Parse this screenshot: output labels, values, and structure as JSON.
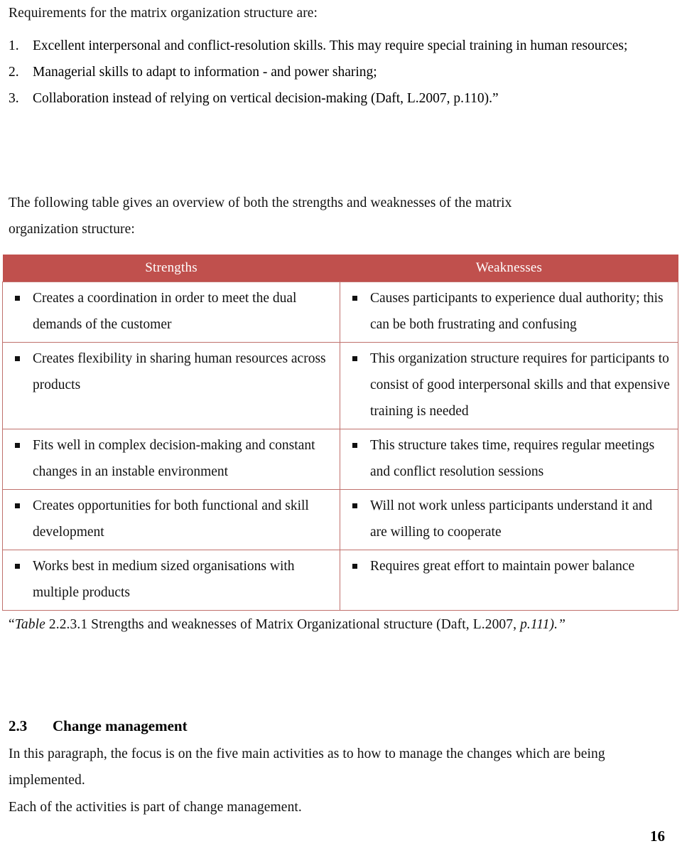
{
  "document": {
    "intro_heading": "Requirements for the matrix organization structure are:",
    "requirements": [
      {
        "num": "1.",
        "text": "Excellent interpersonal and conflict-resolution skills. This may require special training in human resources;"
      },
      {
        "num": "2.",
        "text": "Managerial skills to adapt to information - and power sharing;"
      },
      {
        "num": "3.",
        "text": "Collaboration instead of relying on vertical decision-making (Daft, L.2007, p.110).”"
      }
    ],
    "lead_paragraph": "The following table gives an overview of both the strengths and weaknesses of the matrix organization structure:",
    "table": {
      "headers": [
        "Strengths",
        "Weaknesses"
      ],
      "header_bg": "#C0504D",
      "header_text_color": "#FFFFFF",
      "border_color": "#C0706C",
      "rows": [
        {
          "strength": "Creates a coordination in order to meet the dual demands of the customer",
          "weakness": "Causes participants to experience dual authority; this can be both frustrating and confusing"
        },
        {
          "strength": "Creates flexibility in sharing human resources across products",
          "weakness": "This organization structure requires for participants to consist of good interpersonal skills and that expensive training is needed"
        },
        {
          "strength": "Fits well in complex decision-making and constant changes in an instable environment",
          "weakness": "This structure takes time, requires regular meetings and conflict resolution sessions"
        },
        {
          "strength": "Creates opportunities for both functional and skill development",
          "weakness": "Will not work unless participants understand it and are willing to cooperate"
        },
        {
          "strength": "Works best in medium sized organisations with multiple products",
          "weakness": "Requires great effort to maintain power balance"
        }
      ]
    },
    "caption": {
      "open_quote": "“",
      "italic_word": "Table",
      "rest": " 2.2.3.1 Strengths and weaknesses of Matrix Organizational structure (Daft, L.2007, ",
      "second_line": "p.111).”"
    },
    "section": {
      "number": "2.3",
      "title": "Change management",
      "paragraph_1": "In this paragraph, the focus is on the five main activities as to how to manage the changes which are being implemented.",
      "paragraph_2": "Each of the activities is part of change management."
    },
    "page_number": "16"
  }
}
